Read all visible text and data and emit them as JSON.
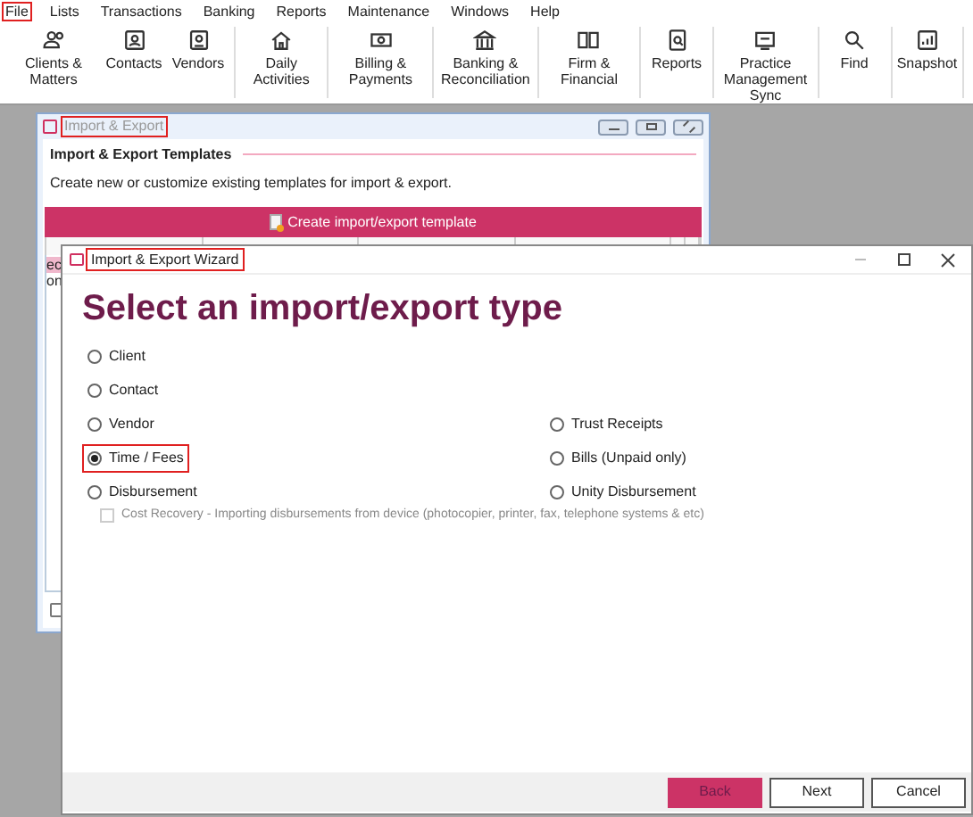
{
  "menu": [
    {
      "label": "File",
      "annotated": true
    },
    {
      "label": "Lists",
      "annotated": false
    },
    {
      "label": "Transactions",
      "annotated": false
    },
    {
      "label": "Banking",
      "annotated": false
    },
    {
      "label": "Reports",
      "annotated": false
    },
    {
      "label": "Maintenance",
      "annotated": false
    },
    {
      "label": "Windows",
      "annotated": false
    },
    {
      "label": "Help",
      "annotated": false
    }
  ],
  "toolbar": [
    {
      "label": "Clients & Matters"
    },
    {
      "label": "Contacts"
    },
    {
      "label": "Vendors"
    },
    {
      "label": "Daily Activities"
    },
    {
      "label": "Billing & Payments"
    },
    {
      "label": "Banking & Reconciliation"
    },
    {
      "label": "Firm & Financial"
    },
    {
      "label": "Reports"
    },
    {
      "label": "Practice Management Sync"
    },
    {
      "label": "Find"
    },
    {
      "label": "Snapshot"
    }
  ],
  "background_window": {
    "title": "Import & Export",
    "title_annotated": true,
    "section_title": "Import & Export Templates",
    "description": "Create new or customize existing templates for import & export.",
    "create_button": "Create import/export template",
    "row_fragments": [
      {
        "text": "ec",
        "selected": true
      },
      {
        "text": "on",
        "selected": false
      }
    ],
    "footer_checkbox": {
      "checked": false
    }
  },
  "wizard": {
    "title": "Import & Export Wizard",
    "title_annotated": true,
    "heading": "Select an import/export type",
    "options_left": [
      {
        "label": "Client",
        "selected": false,
        "annotated": false
      },
      {
        "label": "Contact",
        "selected": false,
        "annotated": false
      },
      {
        "label": "Vendor",
        "selected": false,
        "annotated": false
      },
      {
        "label": "Time / Fees",
        "selected": true,
        "annotated": true
      },
      {
        "label": "Disbursement",
        "selected": false,
        "annotated": false
      }
    ],
    "options_right": [
      {
        "label": "Trust Receipts",
        "selected": false
      },
      {
        "label": "Bills (Unpaid only)",
        "selected": false
      },
      {
        "label": "Unity Disbursement",
        "selected": false
      }
    ],
    "cost_recovery": {
      "label": "Cost Recovery - Importing disbursements from device (photocopier,  printer, fax, telephone systems & etc)",
      "checked": false,
      "disabled": true
    },
    "buttons": [
      {
        "label": "Back",
        "kind": "primary"
      },
      {
        "label": "Next",
        "kind": "default"
      },
      {
        "label": "Cancel",
        "kind": "default"
      }
    ]
  }
}
